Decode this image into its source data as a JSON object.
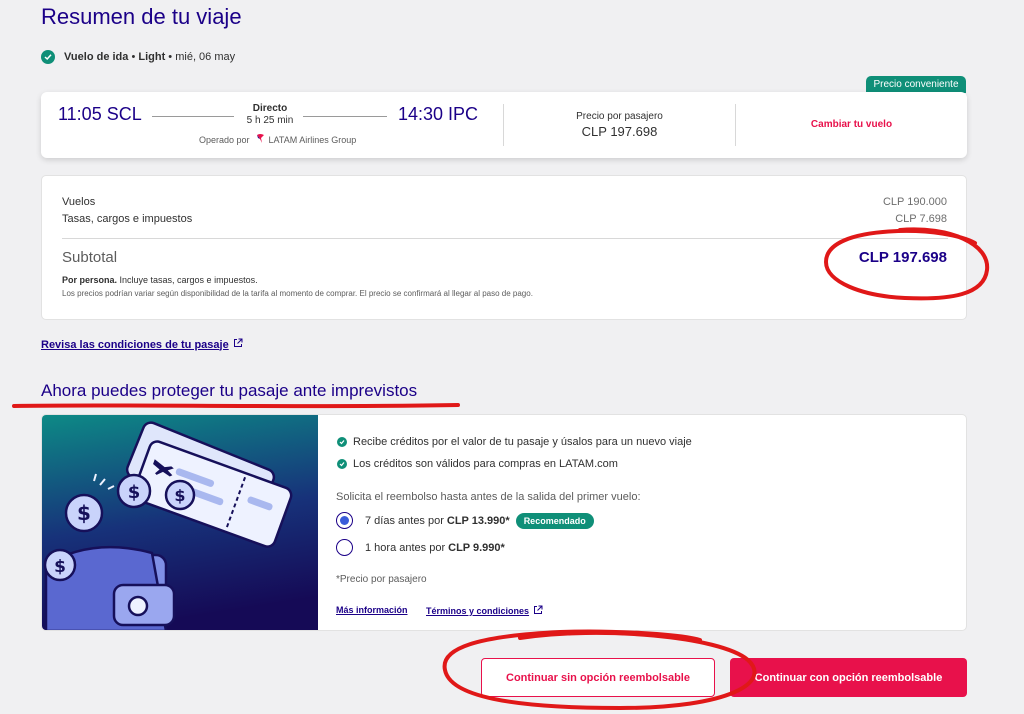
{
  "page": {
    "title": "Resumen de tu viaje"
  },
  "outbound": {
    "label": "Vuelo de ida",
    "sep1": " • ",
    "fare": "Light",
    "sep2": " • ",
    "date": "mié, 06 may"
  },
  "flight": {
    "badge": "Precio conveniente",
    "departure": "11:05 SCL",
    "arrival": "14:30 IPC",
    "type": "Directo",
    "duration": "5 h 25 min",
    "operated_label": "Operado por",
    "operator": "LATAM Airlines Group",
    "price_label": "Precio por pasajero",
    "price_value": "CLP 197.698",
    "change_label": "Cambiar tu vuelo"
  },
  "summary": {
    "flights_label": "Vuelos",
    "flights_value": "CLP 190.000",
    "taxes_label": "Tasas, cargos e impuestos",
    "taxes_value": "CLP 7.698",
    "subtotal_label": "Subtotal",
    "subtotal_value": "CLP 197.698",
    "per_person_bold": "Por persona.",
    "per_person_text": " Incluye tasas, cargos e impuestos.",
    "disclaimer": "Los precios podrían variar según disponibilidad de la tarifa al momento de comprar. El precio se confirmará al llegar al paso de pago."
  },
  "conditions_link": "Revisa las condiciones de tu pasaje",
  "protection": {
    "title": "Ahora puedes proteger tu pasaje ante imprevistos",
    "benefits": [
      "Recibe créditos por el valor de tu pasaje y úsalos para un nuevo viaje",
      "Los créditos son válidos para compras en LATAM.com"
    ],
    "request_label": "Solicita el reembolso hasta antes de la salida del primer vuelo:",
    "options": [
      {
        "text": "7 días antes por",
        "price": "CLP 13.990*",
        "badge": "Recomendado",
        "selected": true
      },
      {
        "text": "1 hora antes por",
        "price": "CLP 9.990*",
        "selected": false
      }
    ],
    "footnote": "*Precio por pasajero",
    "more_info": "Más información",
    "terms": "Términos y condiciones"
  },
  "buttons": {
    "without": "Continuar sin opción reembolsable",
    "with": "Continuar con opción reembolsable"
  },
  "colors": {
    "brand_navy": "#1b0088",
    "accent_pink": "#e8114b",
    "teal": "#0f8f78",
    "annotation_red": "#e01818"
  }
}
